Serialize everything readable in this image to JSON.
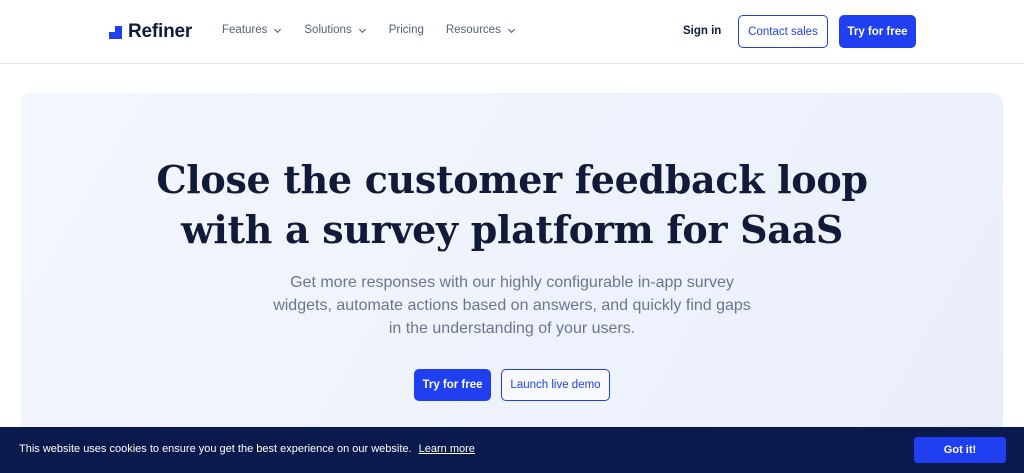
{
  "brand": {
    "name": "Refiner",
    "accent": "#1f3ff0"
  },
  "nav": {
    "items": [
      {
        "label": "Features",
        "has_dropdown": true
      },
      {
        "label": "Solutions",
        "has_dropdown": true
      },
      {
        "label": "Pricing",
        "has_dropdown": false
      },
      {
        "label": "Resources",
        "has_dropdown": true
      }
    ],
    "sign_in": "Sign in",
    "contact_sales": "Contact sales",
    "try_free": "Try for free"
  },
  "hero": {
    "headline_line1": "Close the customer feedback loop",
    "headline_line2": "with a survey platform for SaaS",
    "subtext_line1": "Get more responses with our highly configurable in-app survey",
    "subtext_line2": "widgets, automate actions based on answers, and quickly find gaps",
    "subtext_line3": "in the understanding of your users.",
    "primary_cta": "Try for free",
    "secondary_cta": "Launch live demo"
  },
  "cookie_banner": {
    "message": "This website uses cookies to ensure you get the best experience on our website.",
    "link": "Learn more",
    "accept": "Got it!",
    "background": "#0b1a4d"
  }
}
